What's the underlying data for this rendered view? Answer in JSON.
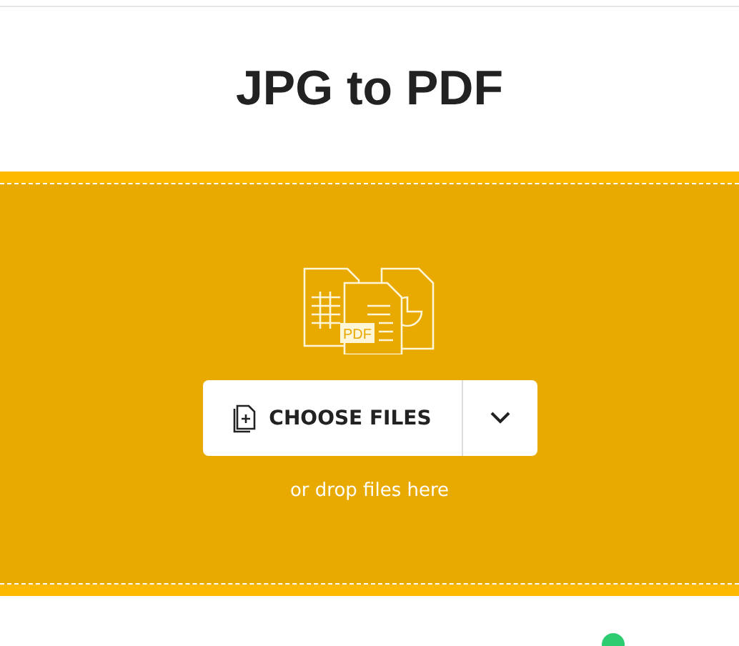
{
  "title": "JPG to PDF",
  "dropzone": {
    "icon_label": "PDF",
    "button": "CHOOSE FILES",
    "hint": "or drop files here"
  }
}
